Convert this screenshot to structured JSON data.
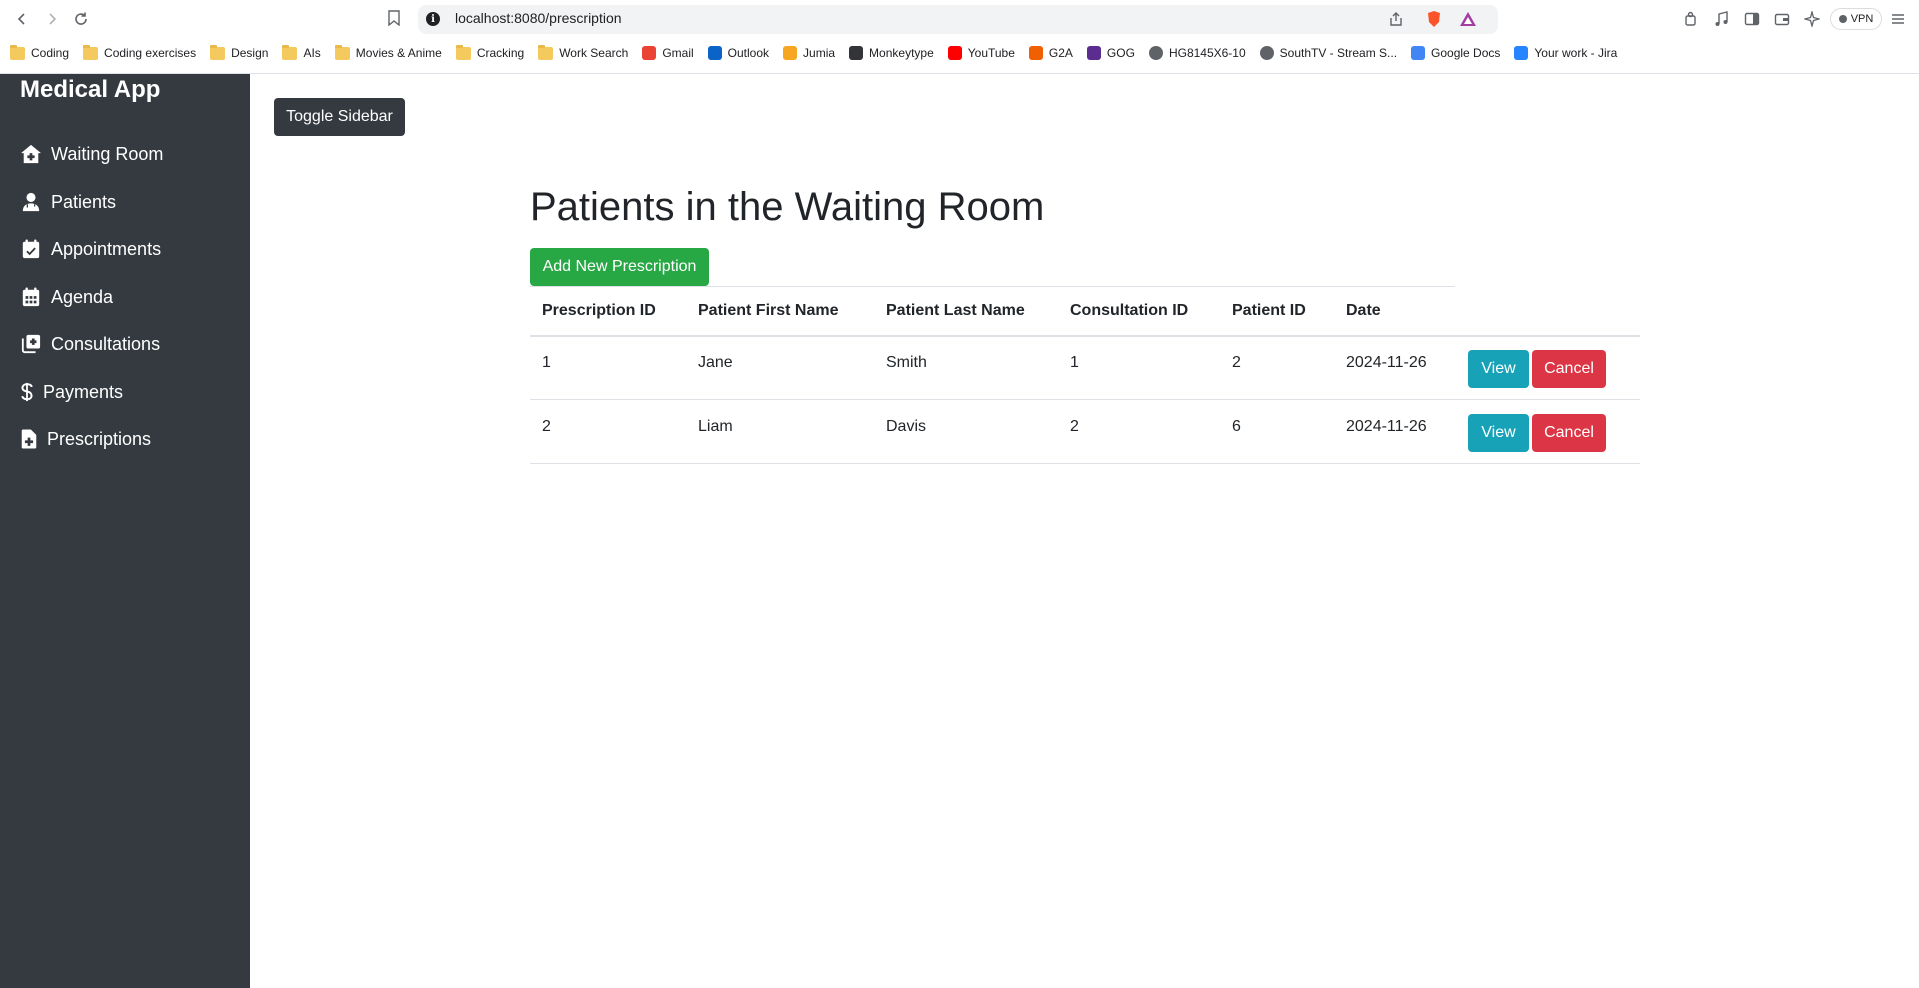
{
  "browser": {
    "url": "localhost:8080/prescription",
    "vpn_label": "VPN",
    "bookmarks": [
      {
        "label": "Coding",
        "icon": "folder-icon"
      },
      {
        "label": "Coding exercises",
        "icon": "folder-icon"
      },
      {
        "label": "Design",
        "icon": "folder-icon"
      },
      {
        "label": "AIs",
        "icon": "folder-icon"
      },
      {
        "label": "Movies & Anime",
        "icon": "folder-icon"
      },
      {
        "label": "Cracking",
        "icon": "folder-icon"
      },
      {
        "label": "Work Search",
        "icon": "folder-icon"
      },
      {
        "label": "Gmail",
        "icon": "gmail-icon",
        "color": "#ea4335"
      },
      {
        "label": "Outlook",
        "icon": "outlook-icon",
        "color": "#0a64c8"
      },
      {
        "label": "Jumia",
        "icon": "jumia-icon",
        "color": "#f6a623"
      },
      {
        "label": "Monkeytype",
        "icon": "monkeytype-icon",
        "color": "#323437"
      },
      {
        "label": "YouTube",
        "icon": "youtube-icon",
        "color": "#ff0000"
      },
      {
        "label": "G2A",
        "icon": "g2a-icon",
        "color": "#f05f00"
      },
      {
        "label": "GOG",
        "icon": "gog-icon",
        "color": "#5c2d91"
      },
      {
        "label": "HG8145X6-10",
        "icon": "globe-icon",
        "color": "#5f6368"
      },
      {
        "label": "SouthTV - Stream S...",
        "icon": "globe-icon",
        "color": "#5f6368"
      },
      {
        "label": "Google Docs",
        "icon": "google-docs-icon",
        "color": "#4285f4"
      },
      {
        "label": "Your work - Jira",
        "icon": "jira-icon",
        "color": "#2684ff"
      }
    ]
  },
  "sidebar": {
    "title": "Medical App",
    "items": [
      {
        "label": "Waiting Room",
        "icon": "house-medical-icon"
      },
      {
        "label": "Patients",
        "icon": "user-doctor-icon"
      },
      {
        "label": "Appointments",
        "icon": "calendar-check-icon"
      },
      {
        "label": "Agenda",
        "icon": "calendar-days-icon"
      },
      {
        "label": "Consultations",
        "icon": "square-plus-icon"
      },
      {
        "label": "Payments",
        "icon": "dollar-sign-icon"
      },
      {
        "label": "Prescriptions",
        "icon": "file-medical-icon"
      }
    ]
  },
  "main": {
    "toggle_label": "Toggle Sidebar",
    "page_title": "Patients in the Waiting Room",
    "add_label": "Add New Prescription",
    "table": {
      "headers": [
        "Prescription ID",
        "Patient First Name",
        "Patient Last Name",
        "Consultation ID",
        "Patient ID",
        "Date"
      ],
      "rows": [
        {
          "prescription_id": "1",
          "first_name": "Jane",
          "last_name": "Smith",
          "consultation_id": "1",
          "patient_id": "2",
          "date": "2024-11-26",
          "view_label": "View",
          "cancel_label": "Cancel"
        },
        {
          "prescription_id": "2",
          "first_name": "Liam",
          "last_name": "Davis",
          "consultation_id": "2",
          "patient_id": "6",
          "date": "2024-11-26",
          "view_label": "View",
          "cancel_label": "Cancel"
        }
      ]
    }
  },
  "colors": {
    "sidebar_bg": "#343a40",
    "success": "#28a745",
    "info": "#17a2b8",
    "danger": "#dc3545"
  }
}
